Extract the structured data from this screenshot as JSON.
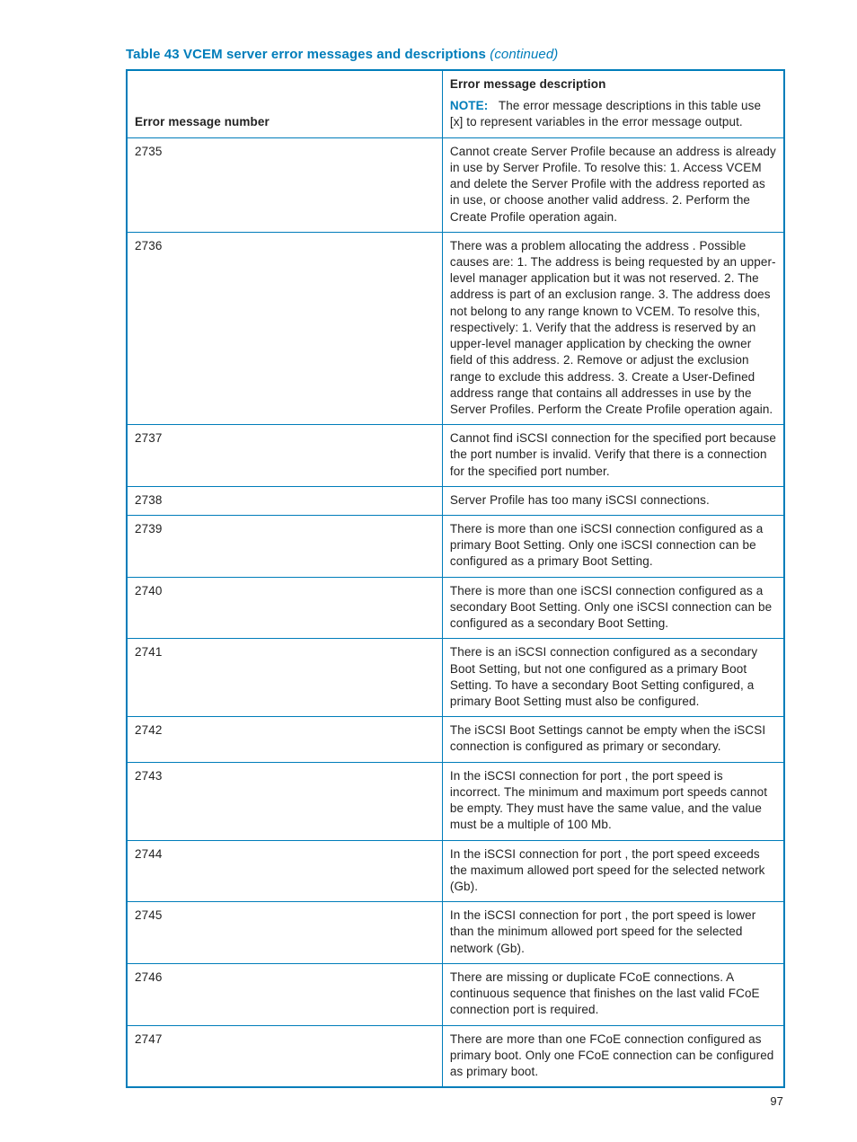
{
  "caption": {
    "title": "Table 43 VCEM server error messages and descriptions",
    "continued": "(continued)"
  },
  "header": {
    "col1": "Error message number",
    "col2_title": "Error message description",
    "col2_note_label": "NOTE:",
    "col2_note_text": "The error message descriptions in this table use [x] to represent variables in the error message output."
  },
  "rows": [
    {
      "num": "2735",
      "desc": "Cannot create Server Profile because an address is already in use by Server Profile. To resolve this: 1. Access VCEM and delete the Server Profile with the address reported as in use, or choose another valid address. 2. Perform the Create Profile operation again."
    },
    {
      "num": "2736",
      "desc": "There was a problem allocating the address . Possible causes are: 1. The address is being requested by an upper-level manager application but it was not reserved. 2. The address is part of an exclusion range. 3. The address does not belong to any range known to VCEM. To resolve this, respectively: 1. Verify that the address is reserved by an upper-level manager application by checking the owner field of this address. 2. Remove or adjust the exclusion range to exclude this address. 3. Create a User-Defined address range that contains all addresses in use by the Server Profiles. Perform the Create Profile operation again."
    },
    {
      "num": "2737",
      "desc": "Cannot find iSCSI connection for the specified port because the port number is invalid. Verify that there is a connection for the specified port number."
    },
    {
      "num": "2738",
      "desc": "Server Profile has too many iSCSI connections."
    },
    {
      "num": "2739",
      "desc": "There is more than one iSCSI connection configured as a primary Boot Setting. Only one iSCSI connection can be configured as a primary Boot Setting."
    },
    {
      "num": "2740",
      "desc": "There is more than one iSCSI connection configured as a secondary Boot Setting. Only one iSCSI connection can be configured as a secondary Boot Setting."
    },
    {
      "num": "2741",
      "desc": "There is an iSCSI connection configured as a secondary Boot Setting, but not one configured as a primary Boot Setting. To have a secondary Boot Setting configured, a primary Boot Setting must also be configured."
    },
    {
      "num": "2742",
      "desc": "The iSCSI Boot Settings cannot be empty when the iSCSI connection is configured as primary or secondary."
    },
    {
      "num": "2743",
      "desc": "In the iSCSI connection for port , the port speed is incorrect. The minimum and maximum port speeds cannot be empty. They must have the same value, and the value must be a multiple of 100 Mb."
    },
    {
      "num": "2744",
      "desc": "In the iSCSI connection for port , the port speed exceeds the maximum allowed port speed for the selected network (Gb)."
    },
    {
      "num": "2745",
      "desc": "In the iSCSI connection for port , the port speed is lower than the minimum allowed port speed for the selected network (Gb)."
    },
    {
      "num": "2746",
      "desc": "There are missing or duplicate FCoE connections. A continuous sequence that finishes on the last valid FCoE connection port is required."
    },
    {
      "num": "2747",
      "desc": "There are more than one FCoE connection configured as primary boot. Only one FCoE connection can be configured as primary boot."
    }
  ],
  "page_number": "97"
}
